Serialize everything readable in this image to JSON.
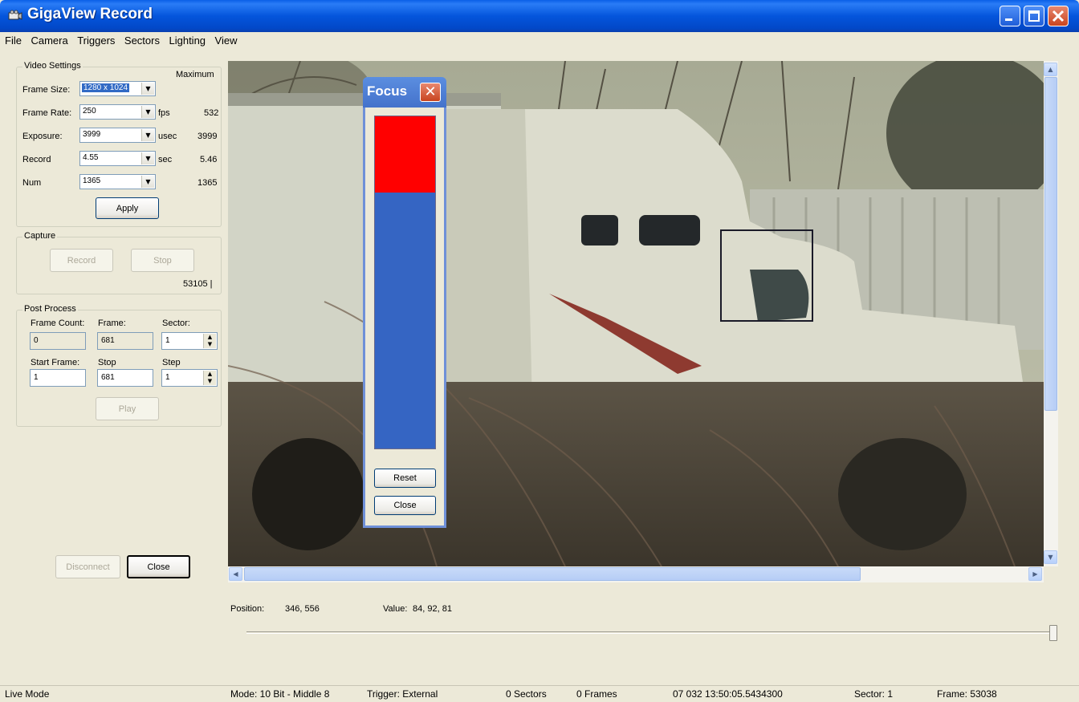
{
  "window": {
    "title": "GigaView Record",
    "icon": "camera-app-icon"
  },
  "menubar": [
    "File",
    "Camera",
    "Triggers",
    "Sectors",
    "Lighting",
    "View"
  ],
  "video_settings": {
    "title": "Video Settings",
    "maximum_label": "Maximum",
    "frame_size": {
      "label": "Frame Size:",
      "value": "1280 x 1024"
    },
    "frame_rate": {
      "label": "Frame Rate:",
      "value": "250",
      "unit": "fps",
      "max": "532"
    },
    "exposure": {
      "label": "Exposure:",
      "value": "3999",
      "unit": "usec",
      "max": "3999"
    },
    "record": {
      "label": "Record",
      "value": "4.55",
      "unit": "sec",
      "max": "5.46"
    },
    "num": {
      "label": "Num",
      "value": "1365",
      "max": "1365"
    },
    "apply_button": "Apply"
  },
  "capture": {
    "title": "Capture",
    "record_button": "Record",
    "stop_button": "Stop",
    "counter": "53105 |"
  },
  "post_process": {
    "title": "Post Process",
    "frame_count_label": "Frame Count:",
    "frame_count_value": "0",
    "frame_label": "Frame:",
    "frame_value": "681",
    "sector_label": "Sector:",
    "sector_value": "1",
    "start_frame_label": "Start Frame:",
    "start_frame_value": "1",
    "stop_label": "Stop",
    "stop_value": "681",
    "step_label": "Step",
    "step_value": "1",
    "play_button": "Play"
  },
  "bottom_buttons": {
    "disconnect": "Disconnect",
    "close": "Close"
  },
  "focus_dialog": {
    "title": "Focus",
    "level": 0.23,
    "fill_color": "#ff0000",
    "meter_color": "#3565c3",
    "reset_button": "Reset",
    "close_button": "Close"
  },
  "readout": {
    "position_label": "Position:",
    "position_value": "346, 556",
    "value_label": "Value:",
    "value_value": "84, 92, 81"
  },
  "statusbar": {
    "mode_live": "Live Mode",
    "mode_bits": "Mode: 10 Bit - Middle 8",
    "trigger": "Trigger: External",
    "sectors": "0 Sectors",
    "frames": "0 Frames",
    "timestamp": "07 032 13:50:05.5434300",
    "sector": "Sector: 1",
    "frame": "Frame: 53038"
  }
}
